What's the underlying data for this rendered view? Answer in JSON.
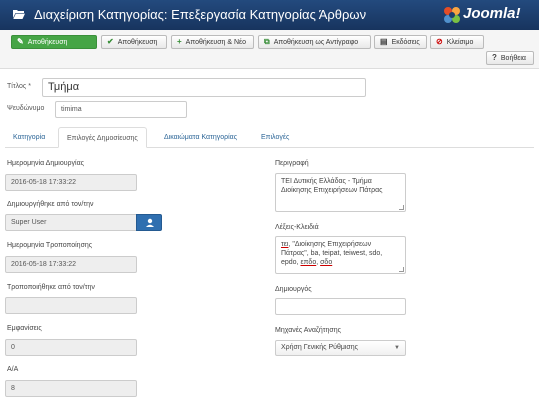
{
  "header": {
    "title": "Διαχείριση Κατηγορίας: Επεξεργασία Κατηγορίας Άρθρων",
    "logo_text": "Joomla!",
    "icon": "folder-open-icon",
    "colors": {
      "bar": "#1c3d6b",
      "logo_red": "#e44d26",
      "logo_orange": "#f9a541",
      "logo_green": "#7ac143",
      "logo_blue": "#5091cd"
    }
  },
  "toolbar": {
    "save_label": "Αποθήκευση",
    "save_close_label": "Αποθήκευση",
    "save_new_label": "Αποθήκευση & Νέο",
    "save_copy_label": "Αποθήκευση ως Αντίγραφο",
    "versions_label": "Εκδόσεις",
    "close_label": "Κλείσιμο",
    "help_label": "Βοήθεια"
  },
  "form": {
    "title_label": "Τίτλος *",
    "title_value": "Τμήμα",
    "alias_label": "Ψευδώνυμο",
    "alias_value": "timima"
  },
  "tabs": [
    "Κατηγορία",
    "Επιλογές Δημοσίευσης",
    "Δικαιώματα Κατηγορίας",
    "Επιλογές"
  ],
  "left": {
    "created_date_label": "Ημερομηνία Δημιουργίας",
    "created_date_value": "2016-05-18 17:33:22",
    "created_by_label": "Δημιουργήθηκε από τον/την",
    "created_by_value": "Super User",
    "modified_date_label": "Ημερομηνία Τροποποίησης",
    "modified_date_value": "2016-05-18 17:33:22",
    "modified_by_label": "Τροποποιήθηκε από τον/την",
    "modified_by_value": "",
    "hits_label": "Εμφανίσεις",
    "hits_value": "0",
    "id_label": "Α/Α",
    "id_value": "8"
  },
  "right": {
    "description_label": "Περιγραφή",
    "description_value": "ΤΕΙ Δυτικής Ελλάδας - Τμήμα Διοίκησης Επιχειρήσεων Πάτρας",
    "keywords_label": "Λέξεις-Κλειδιά",
    "keywords_line1_a": "τει",
    "keywords_line1_b": ", \"Διοίκησης Επιχειρήσεων",
    "keywords_line2": "Πάτρας\", ba, teipat, teiwest, sdo,",
    "keywords_line3_a": "epdo, ",
    "keywords_line3_b": "επδο",
    "keywords_line3_c": ", ",
    "keywords_line3_d": "σδο",
    "author_label": "Δημιουργός",
    "author_value": "",
    "robots_label": "Μηχανές Αναζήτησης",
    "robots_value": "Χρήση Γενικής Ρύθμισης"
  }
}
